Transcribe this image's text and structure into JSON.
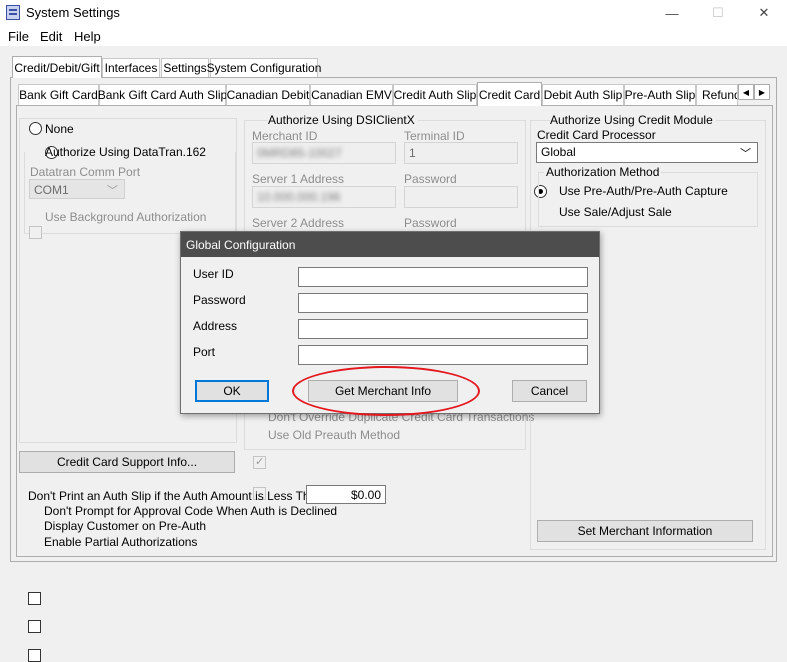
{
  "window": {
    "title": "System Settings",
    "minimize": "—",
    "maximize": "☐",
    "close": "✕"
  },
  "menu": [
    "File",
    "Edit",
    "Help"
  ],
  "outer_tabs": [
    "Credit/Debit/Gift",
    "Interfaces",
    "Settings",
    "System Configuration"
  ],
  "inner_tabs": [
    "Bank Gift Card",
    "Bank Gift Card Auth Slip",
    "Canadian Debit",
    "Canadian EMV",
    "Credit Auth Slip",
    "Credit Card",
    "Debit Auth Slip",
    "Pre-Auth Slip",
    "Refund"
  ],
  "tab_scroll": {
    "left": "◀",
    "right": "▶"
  },
  "left": {
    "none": "None",
    "datatran": "Authorize Using DataTran.162",
    "comm_port_label": "Datatran Comm Port",
    "comm_port_value": "COM1",
    "background_auth": "Use Background Authorization",
    "support_btn": "Credit Card Support Info..."
  },
  "middle": {
    "dsiclientx": "Authorize Using DSIClientX",
    "merchant_id_label": "Merchant ID",
    "merchant_id_value": "0MRD85-10027",
    "terminal_id_label": "Terminal ID",
    "terminal_id_value": "1",
    "server1_label": "Server 1 Address",
    "server1_value": "10.000.000.196",
    "password1_label": "Password",
    "server2_label": "Server 2 Address",
    "password2_label": "Password",
    "dont_override": "Don't Override Duplicate Credit Card Transactions",
    "old_preauth": "Use Old Preauth Method"
  },
  "right": {
    "credit_module": "Authorize Using Credit Module",
    "processor_label": "Credit Card Processor",
    "processor_value": "Global",
    "auth_method_title": "Authorization Method",
    "use_preauth": "Use Pre-Auth/Pre-Auth Capture",
    "use_sale": "Use Sale/Adjust Sale",
    "set_merchant": "Set Merchant Information"
  },
  "bottom": {
    "dont_print_label": "Don't Print an Auth Slip if the Auth Amount is Less Than",
    "dont_print_value": "$0.00",
    "dont_prompt": "Don't Prompt for Approval Code When Auth is Declined",
    "display_customer": "Display Customer on Pre-Auth",
    "partial_auth": "Enable Partial Authorizations"
  },
  "dialog": {
    "title": "Global Configuration",
    "user_id": "User ID",
    "password": "Password",
    "address": "Address",
    "port": "Port",
    "ok": "OK",
    "get_merchant": "Get Merchant Info",
    "cancel": "Cancel"
  },
  "colors": {
    "highlight": "#e3171d",
    "dialog_title_bg": "#4d4d4d"
  }
}
